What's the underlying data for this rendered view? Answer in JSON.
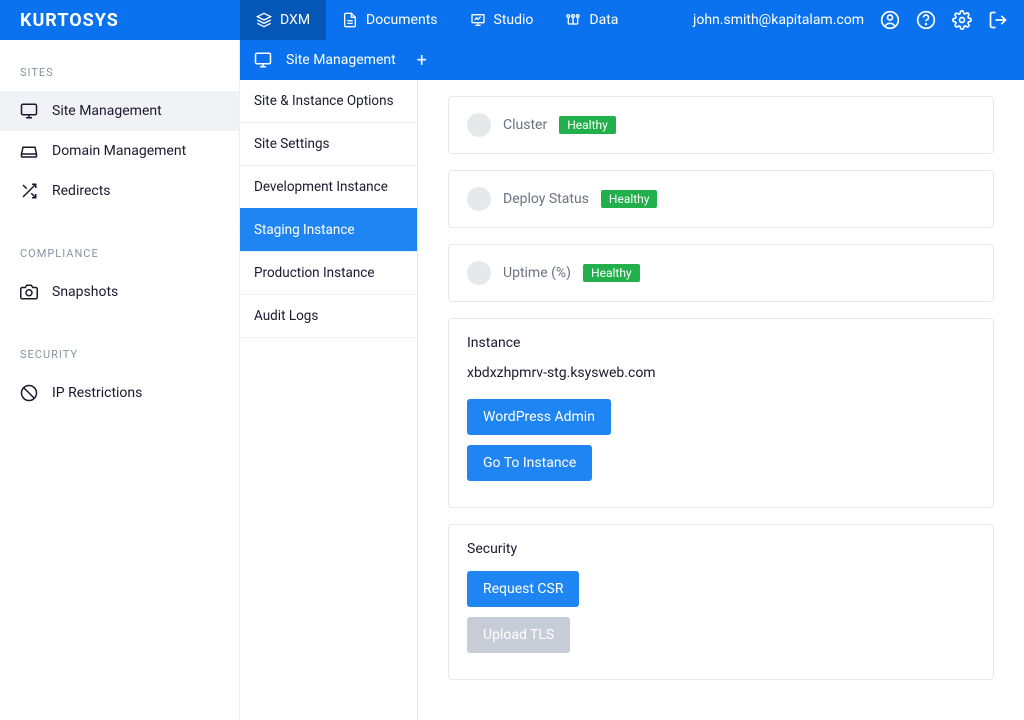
{
  "brand": "KURTOSYS",
  "topnav": {
    "items": [
      {
        "label": "DXM",
        "active": true
      },
      {
        "label": "Documents"
      },
      {
        "label": "Studio"
      },
      {
        "label": "Data"
      }
    ],
    "email": "john.smith@kapitalam.com"
  },
  "subbar": {
    "title": "Site Management"
  },
  "sidebar": {
    "sections": [
      {
        "heading": "SITES",
        "items": [
          {
            "label": "Site Management",
            "active": true
          },
          {
            "label": "Domain Management"
          },
          {
            "label": "Redirects"
          }
        ]
      },
      {
        "heading": "COMPLIANCE",
        "items": [
          {
            "label": "Snapshots"
          }
        ]
      },
      {
        "heading": "SECURITY",
        "items": [
          {
            "label": "IP Restrictions"
          }
        ]
      }
    ]
  },
  "subnav": {
    "items": [
      {
        "label": "Site & Instance Options"
      },
      {
        "label": "Site Settings"
      },
      {
        "label": "Development Instance"
      },
      {
        "label": "Staging Instance",
        "active": true
      },
      {
        "label": "Production Instance"
      },
      {
        "label": "Audit Logs"
      }
    ]
  },
  "status": [
    {
      "label": "Cluster",
      "badge": "Healthy"
    },
    {
      "label": "Deploy Status",
      "badge": "Healthy"
    },
    {
      "label": "Uptime (%)",
      "badge": "Healthy"
    }
  ],
  "instance": {
    "heading": "Instance",
    "url": "xbdxzhpmrv-stg.ksysweb.com",
    "buttons": [
      {
        "label": "WordPress Admin"
      },
      {
        "label": "Go To Instance"
      }
    ]
  },
  "security": {
    "heading": "Security",
    "buttons": [
      {
        "label": "Request CSR",
        "disabled": false
      },
      {
        "label": "Upload TLS",
        "disabled": true
      }
    ]
  }
}
